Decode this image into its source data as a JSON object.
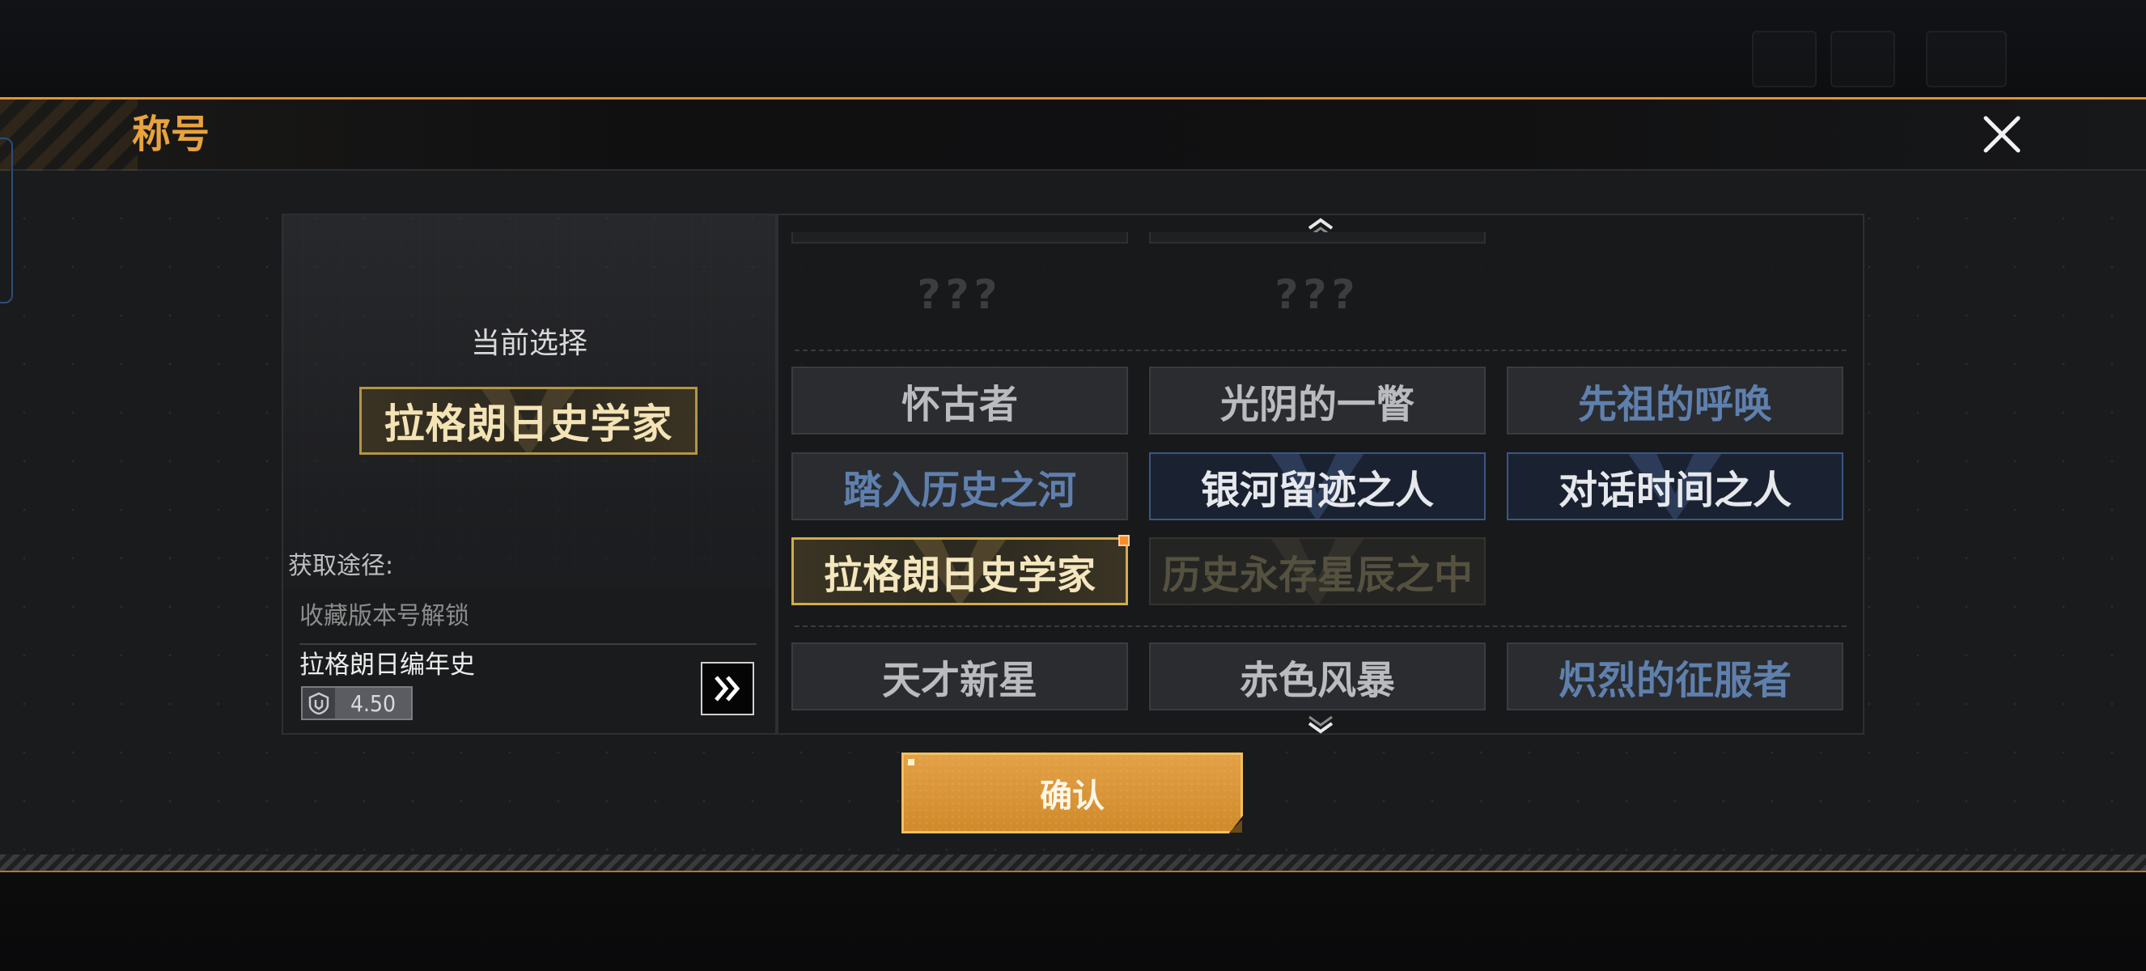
{
  "header": {
    "title": "称号"
  },
  "current": {
    "label": "当前选择",
    "title": "拉格朗日史学家"
  },
  "source": {
    "label": "获取途径:",
    "item1": "收藏版本号解锁",
    "item2": "拉格朗日编年史",
    "version": "4.50"
  },
  "grid": {
    "locked": [
      "???",
      "???"
    ],
    "row1": [
      "怀古者",
      "光阴的一瞥",
      "先祖的呼唤"
    ],
    "row2": [
      "踏入历史之河",
      "银河留迹之人",
      "对话时间之人"
    ],
    "row3": [
      "拉格朗日史学家",
      "历史永存星辰之中"
    ],
    "row4": [
      "天才新星",
      "赤色风暴",
      "炽烈的征服者"
    ]
  },
  "confirm_label": "确认",
  "colors": {
    "accent": "#e0932f",
    "gold_border": "#d1ac4d",
    "blue_text": "#5f80ad",
    "blue_border": "#3b5682"
  }
}
